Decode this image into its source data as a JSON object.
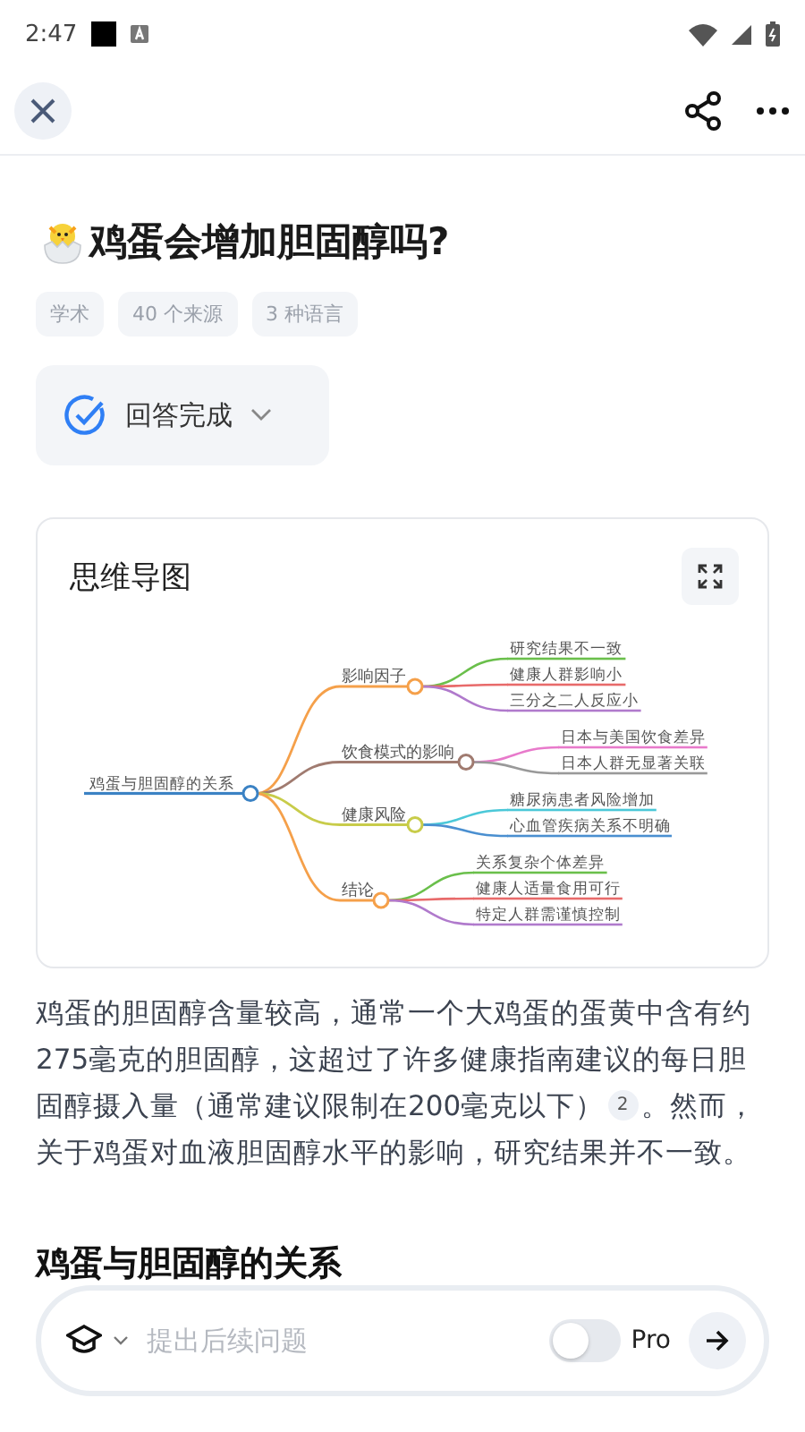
{
  "status_bar": {
    "time": "2:47"
  },
  "title": "鸡蛋会增加胆固醇吗?",
  "tags": [
    "学术",
    "40 个来源",
    "3 种语言"
  ],
  "answer_status": {
    "label": "回答完成"
  },
  "mind_map": {
    "title": "思维导图",
    "root": {
      "label": "鸡蛋与胆固醇的关系",
      "color": "#3b82c4",
      "children": [
        {
          "label": "影响因子",
          "color": "#f5a04a",
          "children": [
            {
              "label": "研究结果不一致",
              "color": "#6abf4b"
            },
            {
              "label": "健康人群影响小",
              "color": "#e86a6a"
            },
            {
              "label": "三分之二人反应小",
              "color": "#b07acc"
            }
          ]
        },
        {
          "label": "饮食模式的影响",
          "color": "#a07b70",
          "children": [
            {
              "label": "日本与美国饮食差异",
              "color": "#e87acb"
            },
            {
              "label": "日本人群无显著关联",
              "color": "#999999"
            }
          ]
        },
        {
          "label": "健康风险",
          "color": "#c8cc4a",
          "children": [
            {
              "label": "糖尿病患者风险增加",
              "color": "#4bc8d8"
            },
            {
              "label": "心血管疾病关系不明确",
              "color": "#4a8fd0"
            }
          ]
        },
        {
          "label": "结论",
          "color": "#f5a04a",
          "children": [
            {
              "label": "关系复杂个体差异",
              "color": "#6abf4b"
            },
            {
              "label": "健康人适量食用可行",
              "color": "#e86a6a"
            },
            {
              "label": "特定人群需谨慎控制",
              "color": "#b07acc"
            }
          ]
        }
      ]
    }
  },
  "paragraph": {
    "before": "鸡蛋的胆固醇含量较高，通常一个大鸡蛋的蛋黄中含有约275毫克的胆固醇，这超过了许多健康指南建议的每日胆固醇摄入量（通常建议限制在200毫克以下）",
    "citation": "2",
    "after": "。然而，关于鸡蛋对血液胆固醇水平的影响，研究结果并不一致。"
  },
  "section_heading": "鸡蛋与胆固醇的关系",
  "input_bar": {
    "placeholder": "提出后续问题",
    "pro_toggle": {
      "label": "Pro",
      "on": false
    }
  }
}
